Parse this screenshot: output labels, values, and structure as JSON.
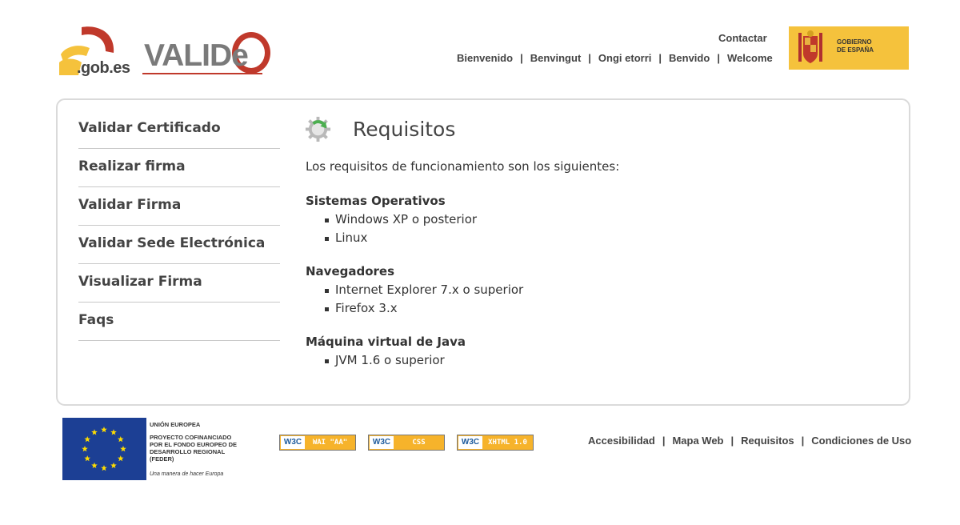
{
  "header": {
    "gob_text": ".gob.es",
    "valide_text": "VALIDe",
    "contact_label": "Contactar",
    "languages": [
      "Bienvenido",
      "Benvingut",
      "Ongi etorri",
      "Benvido",
      "Welcome"
    ],
    "separator": "|",
    "gobierno_label_1": "GOBIERNO",
    "gobierno_label_2": "DE ESPAÑA"
  },
  "sidebar": {
    "items": [
      {
        "label": "Validar Certificado"
      },
      {
        "label": "Realizar firma"
      },
      {
        "label": "Validar Firma"
      },
      {
        "label": "Validar Sede Electrónica"
      },
      {
        "label": "Visualizar Firma"
      },
      {
        "label": "Faqs"
      }
    ]
  },
  "content": {
    "title": "Requisitos",
    "intro": "Los requisitos de funcionamiento son los siguientes:",
    "sections": [
      {
        "heading": "Sistemas Operativos",
        "items": [
          "Windows XP o posterior",
          "Linux"
        ]
      },
      {
        "heading": "Navegadores",
        "items": [
          "Internet Explorer 7.x o superior",
          "Firefox 3.x"
        ]
      },
      {
        "heading": "Máquina virtual de Java",
        "items": [
          "JVM 1.6 o superior"
        ]
      }
    ]
  },
  "footer": {
    "eu_line1": "UNIÓN EUROPEA",
    "eu_line2": "PROYECTO COFINANCIADO",
    "eu_line3": "POR EL FONDO EUROPEO DE",
    "eu_line4": "DESARROLLO REGIONAL",
    "eu_line5": "(FEDER)",
    "eu_slogan": "Una manera de hacer Europa",
    "badges": [
      {
        "w3c": "W3C",
        "tag": "WAI \"AA\""
      },
      {
        "w3c": "W3C",
        "tag": "CSS"
      },
      {
        "w3c": "W3C",
        "tag": "XHTML 1.0"
      }
    ],
    "links": [
      "Accesibilidad",
      "Mapa Web",
      "Requisitos",
      "Condiciones de Uso"
    ],
    "separator": "|"
  },
  "colors": {
    "gob_red": "#c0392b",
    "gob_yellow": "#f5c23c",
    "eu_blue": "#1c3f94",
    "eu_star": "#ffdd00",
    "badge_orange": "#f6b32b",
    "gear_green": "#4caf50"
  },
  "icons": {
    "header_logo": "gob-es-logo",
    "app_logo": "valide-logo",
    "gobierno": "coat-of-arms-icon",
    "content": "gear-refresh-icon",
    "eu": "eu-flag-icon"
  }
}
